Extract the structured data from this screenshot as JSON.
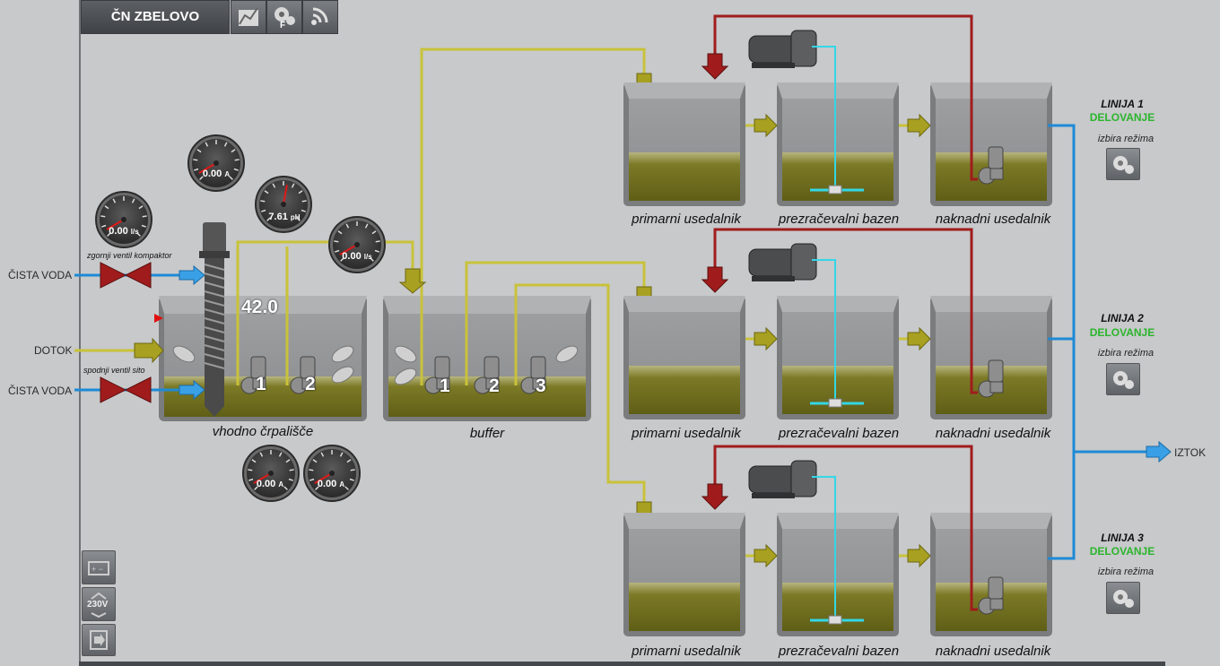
{
  "station_title": "ČN ZBELOVO",
  "toolbar": [
    "chart-icon",
    "settings-f-icon",
    "wireless-icon"
  ],
  "toolbar_f": "F",
  "inputs": {
    "clean_water_top": "ČISTA VODA",
    "inflow": "DOTOK",
    "clean_water_bottom": "ČISTA VODA"
  },
  "valves": {
    "upper": "zgornji ventil kompaktor",
    "lower": "spodnji ventil sito"
  },
  "gauges": [
    {
      "value": "0.00",
      "unit": "l/s"
    },
    {
      "value": "0.00",
      "unit": "A"
    },
    {
      "value": "7.61",
      "unit": "pH"
    },
    {
      "value": "0.00",
      "unit": "l/s"
    },
    {
      "value": "0.00",
      "unit": "A"
    },
    {
      "value": "0.00",
      "unit": "A"
    }
  ],
  "level_value": "42.0",
  "tanks": {
    "inlet": "vhodno črpališče",
    "buffer": "buffer"
  },
  "pumps_inlet": [
    "1",
    "2"
  ],
  "pumps_buffer": [
    "1",
    "2",
    "3"
  ],
  "lines": [
    {
      "title": "LINIJA 1",
      "status": "DELOVANJE",
      "mode": "izbira režima",
      "primary": "primarni usedalnik",
      "aeration": "prezračevalni bazen",
      "secondary": "naknadni usedalnik"
    },
    {
      "title": "LINIJA 2",
      "status": "DELOVANJE",
      "mode": "izbira režima",
      "primary": "primarni usedalnik",
      "aeration": "prezračevalni bazen",
      "secondary": "naknadni usedalnik"
    },
    {
      "title": "LINIJA 3",
      "status": "DELOVANJE",
      "mode": "izbira režima",
      "primary": "primarni usedalnik",
      "aeration": "prezračevalni bazen",
      "secondary": "naknadni usedalnik"
    }
  ],
  "outflow": "IZTOK",
  "left_buttons": [
    "battery-icon",
    "voltage-icon",
    "exit-icon"
  ],
  "voltage_label": "230V",
  "colors": {
    "sludge": "#6b6a1c",
    "pipe_yellow": "#c9c23a",
    "pipe_red": "#a01c1c",
    "pipe_blue": "#1e8ad6",
    "air_cyan": "#34d6e6",
    "status_green": "#2bb52b"
  }
}
